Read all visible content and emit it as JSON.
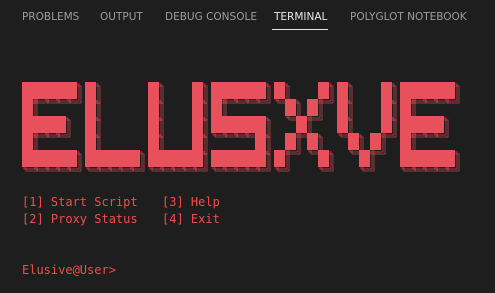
{
  "tabs": [
    {
      "label": "PROBLEMS",
      "active": false
    },
    {
      "label": "OUTPUT",
      "active": false
    },
    {
      "label": "DEBUG CONSOLE",
      "active": false
    },
    {
      "label": "TERMINAL",
      "active": true
    },
    {
      "label": "POLYGLOT NOTEBOOK",
      "active": false
    }
  ],
  "terminal": {
    "banner_text": "ELUSXVE",
    "menu": [
      "[1] Start Script",
      "[2] Proxy Status",
      "[3] Help",
      "[4] Exit"
    ],
    "prompt": "Elusive@User>"
  },
  "colors": {
    "background": "#1e1e1e",
    "tab_inactive": "#9d9d9d",
    "tab_active": "#e7e7e7",
    "accent_red": "#f14c4c",
    "banner_fill": "#e8505b",
    "banner_outline": "#e8505b"
  }
}
